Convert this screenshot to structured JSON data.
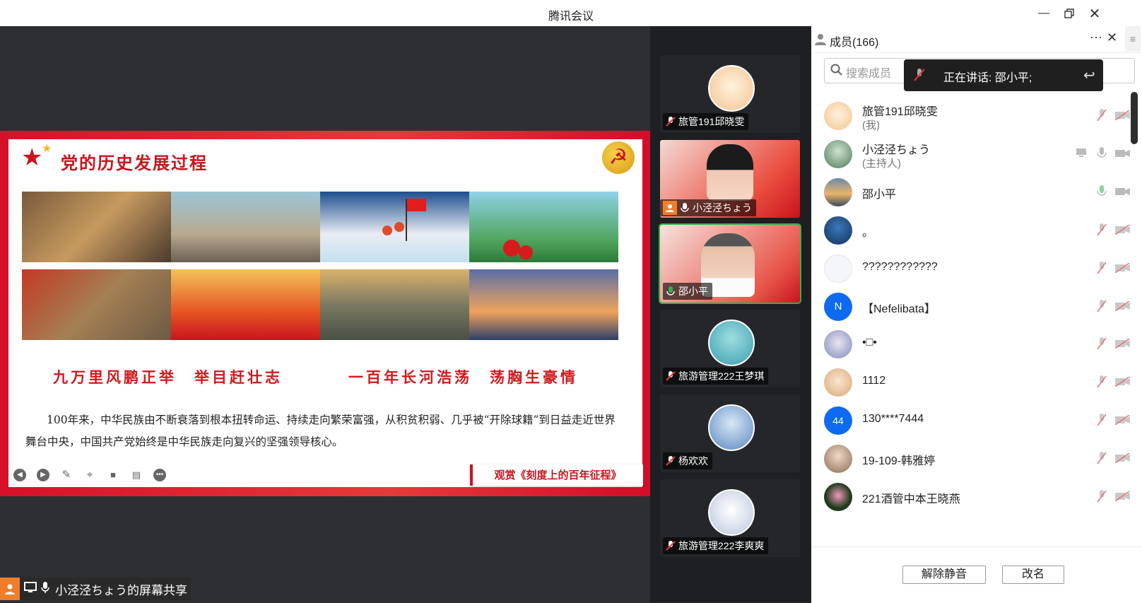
{
  "window": {
    "title": "腾讯会议"
  },
  "slide": {
    "title": "党的历史发展过程",
    "slogan_left": "九万里风鹏正举　举目赶壮志",
    "slogan_right": "一百年长河浩荡　荡胸生豪情",
    "paragraph": "100年来，中华民族由不断衰落到根本扭转命运、持续走向繁荣富强，从积贫积弱、几乎被“开除球籍”到日益走近世界舞台中央，中国共产党始终是中华民族走向复兴的坚强领导核心。",
    "watch_button": "观赏《刻度上的百年征程》"
  },
  "share_bar": {
    "label": "小泾泾ちょう的屏幕共享"
  },
  "video_tiles": [
    {
      "name": "旅管191邱晓雯",
      "muted": true
    },
    {
      "name": "小泾泾ちょう",
      "muted": false,
      "host": true
    },
    {
      "name": "邵小平",
      "muted": false,
      "speaking": true
    },
    {
      "name": "旅游管理222王梦琪",
      "muted": true
    },
    {
      "name": "杨欢欢",
      "muted": true
    },
    {
      "name": "旅游管理222李爽爽",
      "muted": true
    }
  ],
  "members_panel": {
    "title": "成员(166)",
    "search_placeholder": "搜索成员",
    "speaking_toast": "正在讲话: 邵小平;",
    "members": [
      {
        "name": "旅管191邱晓雯",
        "sub": "(我)",
        "mic": "muted",
        "cam": "off"
      },
      {
        "name": "小泾泾ちょう",
        "sub": "(主持人)",
        "mic": "on",
        "cam": "on"
      },
      {
        "name": "邵小平",
        "sub": "",
        "mic": "on",
        "cam": "on"
      },
      {
        "name": "。",
        "sub": "",
        "mic": "muted",
        "cam": "off"
      },
      {
        "name": "????????????",
        "sub": "",
        "mic": "muted",
        "cam": "off"
      },
      {
        "name": "【Nefelibata】",
        "sub": "",
        "avatar_text": "N",
        "mic": "muted",
        "cam": "off"
      },
      {
        "name": "•□•",
        "sub": "",
        "mic": "muted",
        "cam": "off"
      },
      {
        "name": "1112",
        "sub": "",
        "mic": "muted",
        "cam": "off"
      },
      {
        "name": "130****7444",
        "sub": "",
        "avatar_text": "44",
        "mic": "muted",
        "cam": "off"
      },
      {
        "name": "19-109-韩雅婷",
        "sub": "",
        "mic": "muted",
        "cam": "off"
      },
      {
        "name": "221酒管中本王晓燕",
        "sub": "",
        "mic": "muted",
        "cam": "off"
      }
    ],
    "unmute_button": "解除静音",
    "rename_button": "改名"
  }
}
